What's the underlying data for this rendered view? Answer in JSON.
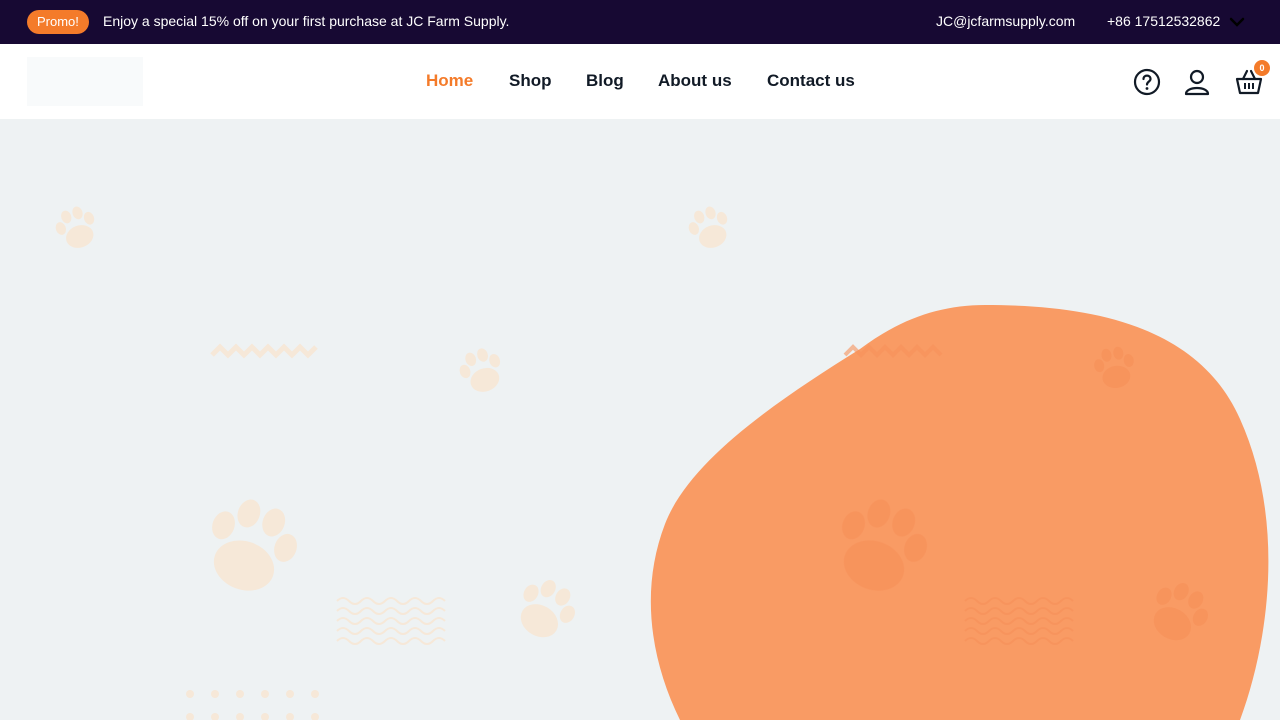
{
  "topbar": {
    "promo_label": "Promo!",
    "promo_text": "Enjoy a special 15% off on your first purchase at JC Farm Supply.",
    "email": "JC@jcfarmsupply.com",
    "phone": "+86 17512532862"
  },
  "nav": {
    "items": [
      {
        "label": "Home",
        "active": true
      },
      {
        "label": "Shop"
      },
      {
        "label": "Blog"
      },
      {
        "label": "About us"
      },
      {
        "label": "Contact us"
      }
    ]
  },
  "header_icons": {
    "help": "question-circle-icon",
    "account": "user-icon",
    "cart": "basket-icon",
    "cart_count": "0"
  },
  "colors": {
    "topbar_bg": "#170933",
    "accent": "#f47b2a",
    "blob": "#f99b64",
    "hero_bg": "#eef2f3",
    "paw": "#f6e8d8"
  }
}
